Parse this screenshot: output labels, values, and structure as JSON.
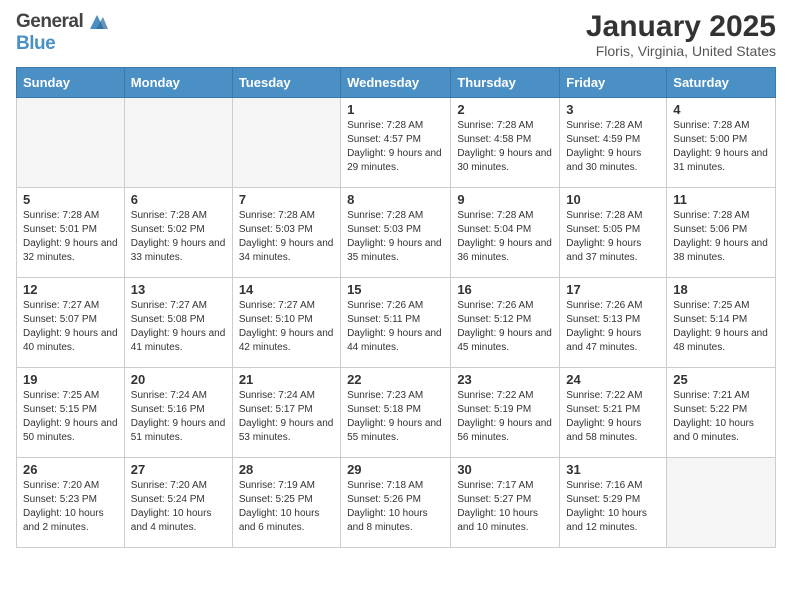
{
  "header": {
    "logo_general": "General",
    "logo_blue": "Blue",
    "title": "January 2025",
    "subtitle": "Floris, Virginia, United States"
  },
  "weekdays": [
    "Sunday",
    "Monday",
    "Tuesday",
    "Wednesday",
    "Thursday",
    "Friday",
    "Saturday"
  ],
  "weeks": [
    [
      {
        "day": "",
        "info": ""
      },
      {
        "day": "",
        "info": ""
      },
      {
        "day": "",
        "info": ""
      },
      {
        "day": "1",
        "info": "Sunrise: 7:28 AM\nSunset: 4:57 PM\nDaylight: 9 hours\nand 29 minutes."
      },
      {
        "day": "2",
        "info": "Sunrise: 7:28 AM\nSunset: 4:58 PM\nDaylight: 9 hours\nand 30 minutes."
      },
      {
        "day": "3",
        "info": "Sunrise: 7:28 AM\nSunset: 4:59 PM\nDaylight: 9 hours\nand 30 minutes."
      },
      {
        "day": "4",
        "info": "Sunrise: 7:28 AM\nSunset: 5:00 PM\nDaylight: 9 hours\nand 31 minutes."
      }
    ],
    [
      {
        "day": "5",
        "info": "Sunrise: 7:28 AM\nSunset: 5:01 PM\nDaylight: 9 hours\nand 32 minutes."
      },
      {
        "day": "6",
        "info": "Sunrise: 7:28 AM\nSunset: 5:02 PM\nDaylight: 9 hours\nand 33 minutes."
      },
      {
        "day": "7",
        "info": "Sunrise: 7:28 AM\nSunset: 5:03 PM\nDaylight: 9 hours\nand 34 minutes."
      },
      {
        "day": "8",
        "info": "Sunrise: 7:28 AM\nSunset: 5:03 PM\nDaylight: 9 hours\nand 35 minutes."
      },
      {
        "day": "9",
        "info": "Sunrise: 7:28 AM\nSunset: 5:04 PM\nDaylight: 9 hours\nand 36 minutes."
      },
      {
        "day": "10",
        "info": "Sunrise: 7:28 AM\nSunset: 5:05 PM\nDaylight: 9 hours\nand 37 minutes."
      },
      {
        "day": "11",
        "info": "Sunrise: 7:28 AM\nSunset: 5:06 PM\nDaylight: 9 hours\nand 38 minutes."
      }
    ],
    [
      {
        "day": "12",
        "info": "Sunrise: 7:27 AM\nSunset: 5:07 PM\nDaylight: 9 hours\nand 40 minutes."
      },
      {
        "day": "13",
        "info": "Sunrise: 7:27 AM\nSunset: 5:08 PM\nDaylight: 9 hours\nand 41 minutes."
      },
      {
        "day": "14",
        "info": "Sunrise: 7:27 AM\nSunset: 5:10 PM\nDaylight: 9 hours\nand 42 minutes."
      },
      {
        "day": "15",
        "info": "Sunrise: 7:26 AM\nSunset: 5:11 PM\nDaylight: 9 hours\nand 44 minutes."
      },
      {
        "day": "16",
        "info": "Sunrise: 7:26 AM\nSunset: 5:12 PM\nDaylight: 9 hours\nand 45 minutes."
      },
      {
        "day": "17",
        "info": "Sunrise: 7:26 AM\nSunset: 5:13 PM\nDaylight: 9 hours\nand 47 minutes."
      },
      {
        "day": "18",
        "info": "Sunrise: 7:25 AM\nSunset: 5:14 PM\nDaylight: 9 hours\nand 48 minutes."
      }
    ],
    [
      {
        "day": "19",
        "info": "Sunrise: 7:25 AM\nSunset: 5:15 PM\nDaylight: 9 hours\nand 50 minutes."
      },
      {
        "day": "20",
        "info": "Sunrise: 7:24 AM\nSunset: 5:16 PM\nDaylight: 9 hours\nand 51 minutes."
      },
      {
        "day": "21",
        "info": "Sunrise: 7:24 AM\nSunset: 5:17 PM\nDaylight: 9 hours\nand 53 minutes."
      },
      {
        "day": "22",
        "info": "Sunrise: 7:23 AM\nSunset: 5:18 PM\nDaylight: 9 hours\nand 55 minutes."
      },
      {
        "day": "23",
        "info": "Sunrise: 7:22 AM\nSunset: 5:19 PM\nDaylight: 9 hours\nand 56 minutes."
      },
      {
        "day": "24",
        "info": "Sunrise: 7:22 AM\nSunset: 5:21 PM\nDaylight: 9 hours\nand 58 minutes."
      },
      {
        "day": "25",
        "info": "Sunrise: 7:21 AM\nSunset: 5:22 PM\nDaylight: 10 hours\nand 0 minutes."
      }
    ],
    [
      {
        "day": "26",
        "info": "Sunrise: 7:20 AM\nSunset: 5:23 PM\nDaylight: 10 hours\nand 2 minutes."
      },
      {
        "day": "27",
        "info": "Sunrise: 7:20 AM\nSunset: 5:24 PM\nDaylight: 10 hours\nand 4 minutes."
      },
      {
        "day": "28",
        "info": "Sunrise: 7:19 AM\nSunset: 5:25 PM\nDaylight: 10 hours\nand 6 minutes."
      },
      {
        "day": "29",
        "info": "Sunrise: 7:18 AM\nSunset: 5:26 PM\nDaylight: 10 hours\nand 8 minutes."
      },
      {
        "day": "30",
        "info": "Sunrise: 7:17 AM\nSunset: 5:27 PM\nDaylight: 10 hours\nand 10 minutes."
      },
      {
        "day": "31",
        "info": "Sunrise: 7:16 AM\nSunset: 5:29 PM\nDaylight: 10 hours\nand 12 minutes."
      },
      {
        "day": "",
        "info": ""
      }
    ]
  ]
}
